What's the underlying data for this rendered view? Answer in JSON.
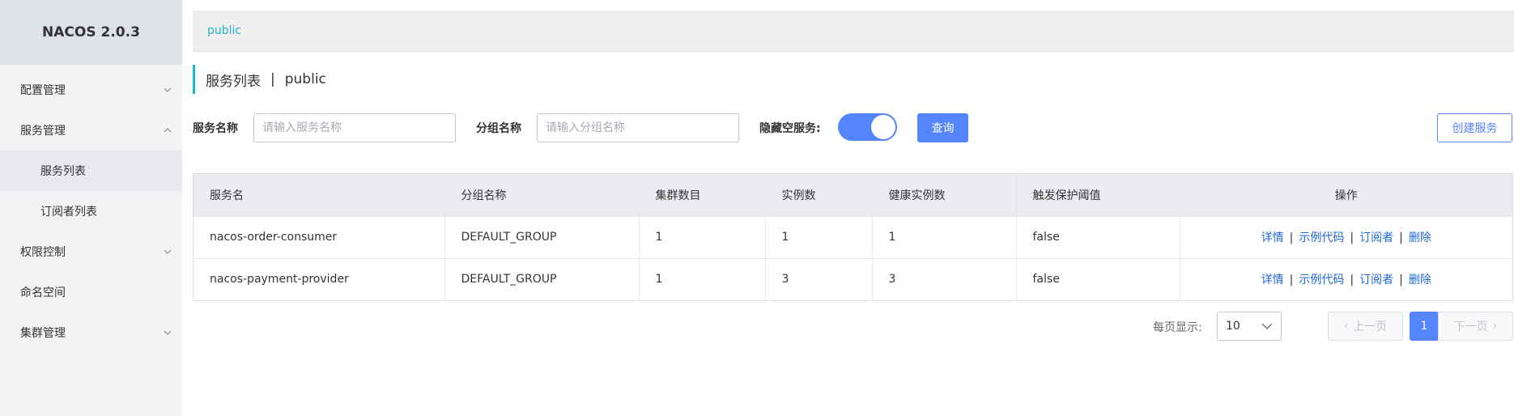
{
  "brand": "NACOS 2.0.3",
  "sidebar": {
    "items": [
      {
        "label": "配置管理"
      },
      {
        "label": "服务管理"
      },
      {
        "label": "服务列表"
      },
      {
        "label": "订阅者列表"
      },
      {
        "label": "权限控制"
      },
      {
        "label": "命名空间"
      },
      {
        "label": "集群管理"
      }
    ]
  },
  "breadcrumb": {
    "namespace": "public"
  },
  "page": {
    "title": "服务列表",
    "separator": "|",
    "namespace": "public"
  },
  "filters": {
    "service_name_label": "服务名称",
    "service_name_placeholder": "请输入服务名称",
    "group_name_label": "分组名称",
    "group_name_placeholder": "请输入分组名称",
    "hide_empty_label": "隐藏空服务:",
    "hide_empty_enabled": true,
    "query_label": "查询",
    "create_label": "创建服务"
  },
  "table": {
    "headers": [
      "服务名",
      "分组名称",
      "集群数目",
      "实例数",
      "健康实例数",
      "触发保护阈值",
      "操作"
    ],
    "rows": [
      [
        "nacos-order-consumer",
        "DEFAULT_GROUP",
        "1",
        "1",
        "1",
        "false"
      ],
      [
        "nacos-payment-provider",
        "DEFAULT_GROUP",
        "1",
        "3",
        "3",
        "false"
      ]
    ],
    "actions": {
      "detail": "详情",
      "sample": "示例代码",
      "subscribers": "订阅者",
      "delete": "删除",
      "sep": "|"
    }
  },
  "pagination": {
    "per_page_label": "每页显示:",
    "page_size": "10",
    "prev": "上一页",
    "next": "下一页",
    "current": "1"
  },
  "colors": {
    "accent": "#5584ff",
    "link": "#1f66d6",
    "crumb": "#1fb6c9"
  }
}
